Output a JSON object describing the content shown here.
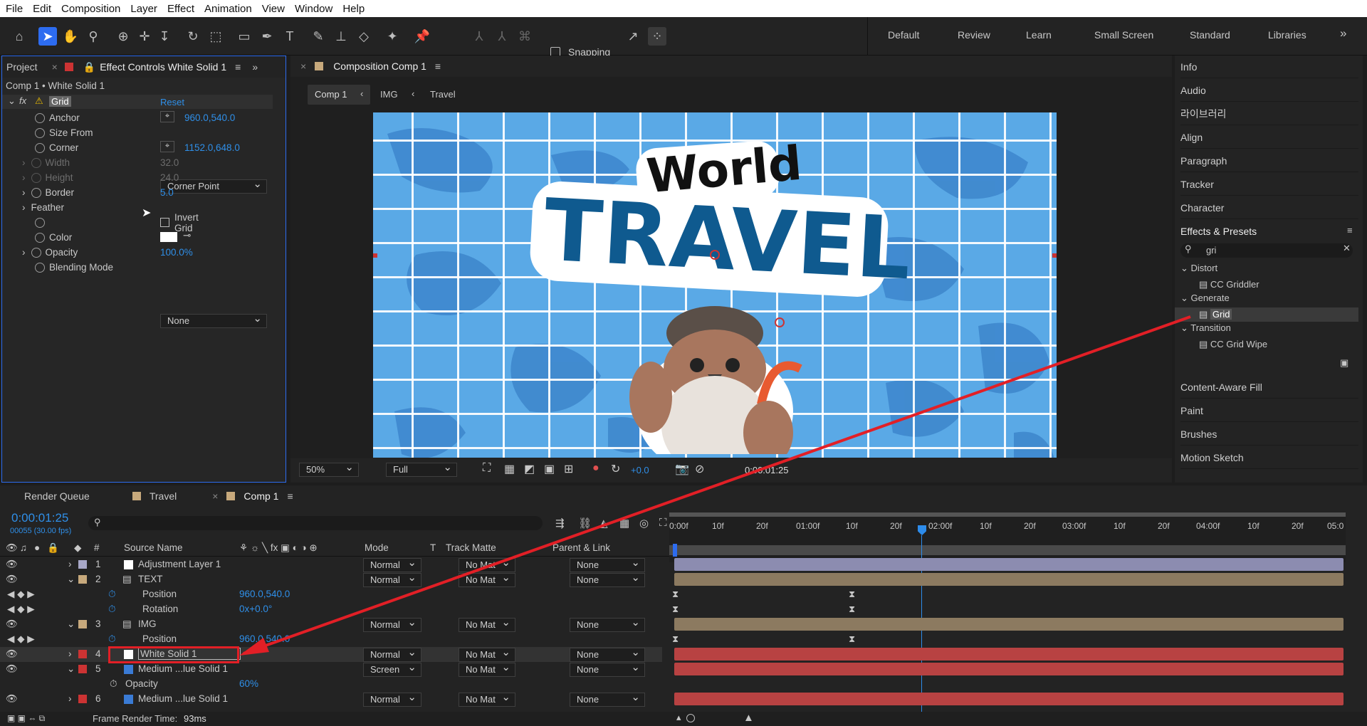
{
  "menu": [
    "File",
    "Edit",
    "Composition",
    "Layer",
    "Effect",
    "Animation",
    "View",
    "Window",
    "Help"
  ],
  "toolbar": {
    "snapping_label": "Snapping"
  },
  "workspaces": [
    "Default",
    "Review",
    "Learn",
    "Small Screen",
    "Standard",
    "Libraries"
  ],
  "left_tabs": {
    "project": "Project",
    "effect_controls": "Effect Controls White Solid 1"
  },
  "effect_controls": {
    "layer_path": "Comp 1 • White Solid 1",
    "effect_name": "Grid",
    "reset": "Reset",
    "props": [
      {
        "label": "Anchor",
        "value": "960.0,540.0"
      },
      {
        "label": "Size From",
        "value": "Corner Point"
      },
      {
        "label": "Corner",
        "value": "1152.0,648.0"
      },
      {
        "label": "Width",
        "value": "32.0"
      },
      {
        "label": "Height",
        "value": "24.0"
      },
      {
        "label": "Border",
        "value": "5.0"
      },
      {
        "label": "Feather",
        "value": ""
      },
      {
        "label": "",
        "value": "Invert Grid"
      },
      {
        "label": "Color",
        "value": ""
      },
      {
        "label": "Opacity",
        "value": "100.0%"
      },
      {
        "label": "Blending Mode",
        "value": "None"
      }
    ]
  },
  "comp_panel": {
    "tab": "Composition Comp 1",
    "crumbs": [
      "Comp 1",
      "IMG",
      "Travel"
    ],
    "zoom": "50%",
    "resolution": "Full",
    "exposure": "+0.0",
    "timecode": "0:00:01:25"
  },
  "artwork": {
    "word1": "World",
    "word2": "TRAVEL"
  },
  "right_panel": {
    "items_top": [
      "Info",
      "Audio",
      "라이브러리",
      "Align",
      "Paragraph",
      "Tracker",
      "Character"
    ],
    "effects_title": "Effects & Presets",
    "search": "gri",
    "tree": [
      {
        "group": "Distort",
        "items": [
          "CC Griddler"
        ]
      },
      {
        "group": "Generate",
        "items": [
          "Grid"
        ]
      },
      {
        "group": "Transition",
        "items": [
          "CC Grid Wipe"
        ]
      }
    ],
    "items_bottom": [
      "Content-Aware Fill",
      "Paint",
      "Brushes",
      "Motion Sketch"
    ]
  },
  "timeline": {
    "tabs": [
      "Render Queue",
      "Travel",
      "Comp 1"
    ],
    "time": "0:00:01:25",
    "fps": "00055 (30.00 fps)",
    "headers": {
      "source": "Source Name",
      "mode": "Mode",
      "t": "T",
      "matte": "Track Matte",
      "parent": "Parent & Link",
      "num": "#"
    },
    "ruler": [
      "0:00f",
      "10f",
      "20f",
      "01:00f",
      "10f",
      "20f",
      "02:00f",
      "10f",
      "20f",
      "03:00f",
      "10f",
      "20f",
      "04:00f",
      "10f",
      "20f",
      "05:0"
    ],
    "layers": [
      {
        "n": "1",
        "name": "Adjustment Layer 1",
        "mode": "Normal",
        "matte": "No Mat",
        "parent": "None"
      },
      {
        "n": "2",
        "name": "TEXT",
        "mode": "Normal",
        "matte": "No Mat",
        "parent": "None"
      },
      {
        "prop": "Position",
        "value": "960.0,540.0"
      },
      {
        "prop": "Rotation",
        "value": "0x+0.0°"
      },
      {
        "n": "3",
        "name": "IMG",
        "mode": "Normal",
        "matte": "No Mat",
        "parent": "None"
      },
      {
        "prop": "Position",
        "value": "960.0,540.0"
      },
      {
        "n": "4",
        "name": "White Solid 1",
        "mode": "Normal",
        "matte": "No Mat",
        "parent": "None"
      },
      {
        "n": "5",
        "name": "Medium ...lue Solid 1",
        "mode": "Screen",
        "matte": "No Mat",
        "parent": "None"
      },
      {
        "prop": "Opacity",
        "value": "60%"
      },
      {
        "n": "6",
        "name": "Medium ...lue Solid 1",
        "mode": "Normal",
        "matte": "No Mat",
        "parent": "None"
      }
    ],
    "render_time_label": "Frame Render Time:",
    "render_time": "93ms"
  },
  "colors": {
    "accent": "#2d8ceb",
    "annotation": "#e21f26",
    "layer_purple": "#a8a8c8",
    "layer_tan": "#8c7a60",
    "layer_red": "#b84242"
  }
}
